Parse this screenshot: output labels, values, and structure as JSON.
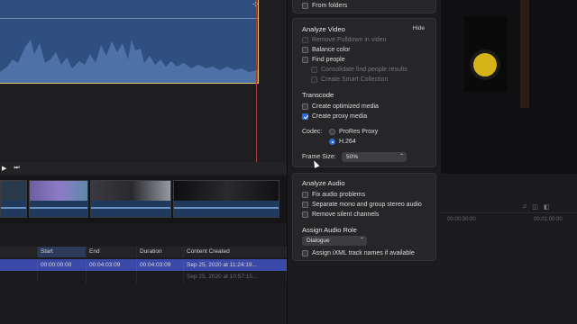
{
  "colors": {
    "accent": "#2d6be8",
    "selection_row": "#3b49a8",
    "waveform": "#2f4f80",
    "playhead": "#a33b3b"
  },
  "transport": {
    "play_icon": "play-icon",
    "next_icon": "next-frame-icon"
  },
  "panel": {
    "top_option": "From folders",
    "analyze_video": {
      "title": "Analyze Video",
      "hide": "Hide",
      "options": [
        {
          "label": "Remove Pulldown in video",
          "checked": false,
          "disabled": true
        },
        {
          "label": "Balance color",
          "checked": false,
          "disabled": false
        },
        {
          "label": "Find people",
          "checked": false,
          "disabled": false
        },
        {
          "label": "Consolidate find people results",
          "checked": false,
          "disabled": true
        },
        {
          "label": "Create Smart Collection",
          "checked": false,
          "disabled": true
        }
      ]
    },
    "transcode": {
      "title": "Transcode",
      "optimized": "Create optimized media",
      "proxy": "Create proxy media",
      "codec_label": "Codec:",
      "codec_options": [
        "ProRes Proxy",
        "H.264"
      ],
      "codec_selected": "H.264",
      "frame_size_label": "Frame Size:",
      "frame_size_value": "50%"
    },
    "analyze_audio": {
      "title": "Analyze Audio",
      "options": [
        "Fix audio problems",
        "Separate mono and group stereo audio",
        "Remove silent channels"
      ]
    },
    "audio_role": {
      "title": "Assign Audio Role",
      "value": "Dialogue",
      "ixml": "Assign iXML track names if available"
    }
  },
  "table": {
    "columns": [
      "Start",
      "End",
      "Duration",
      "Content Created"
    ],
    "rows": [
      {
        "start": "00:00:00:00",
        "end": "00:04:03:09",
        "duration": "00:04:03:09",
        "created": "Sep 25, 2020 at 11:24:19..."
      },
      {
        "start": "",
        "end": "",
        "duration": "",
        "created": "Sep 25, 2020 at 10:57:15..."
      }
    ]
  },
  "timecodes": [
    "00:00:30:00",
    "00:01:00:00"
  ]
}
